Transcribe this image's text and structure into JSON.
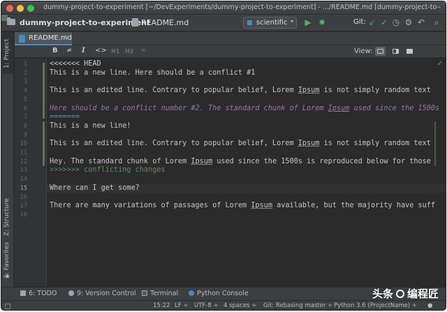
{
  "window": {
    "title": "dummy-project-to-experiment [~/DevExperiments/dummy-project-to-experiment] - .../README.md [dummy-project-to-experiment]"
  },
  "navbar": {
    "project": "dummy-project-to-experiment",
    "file": "README.md",
    "run_config": "scientific",
    "git_label": "Git:"
  },
  "left_tools": {
    "project": "1: Project",
    "structure": "Z: Structure",
    "favorites": "2: Favorites"
  },
  "tabs": [
    {
      "label": "README.md"
    }
  ],
  "md_toolbar": {
    "bold": "B",
    "strike": "≠",
    "italic": "I",
    "code": "<>",
    "h1": "H1",
    "h2": "H2",
    "link": "∞",
    "view_label": "View:"
  },
  "editor": {
    "current_line": 15,
    "line_numbers": [
      "1",
      "2",
      "3",
      "4",
      "5",
      "6",
      "7",
      "8",
      "9",
      "10",
      "11",
      "12",
      "13",
      "14",
      "15",
      "16",
      "17",
      "18"
    ],
    "lines": [
      "<<<<<<< HEAD",
      "This is a new line. Here should be a conflict #1",
      "",
      "This is an edited line. Contrary to popular belief, Lorem Ipsum is not simply random text",
      "",
      "Here should be a conflict number #2. The standard chunk of Lorem Ipsum used since the 1500s",
      "=======",
      "This is a new line!",
      "",
      "This is an edited line. Contrary to popular belief, Lorem Ipsum is not simply random text",
      "",
      "Hey. The standard chunk of Lorem Ipsum used since the 1500s is reproduced below for those",
      ">>>>>>> conflicting changes",
      "",
      "Where can I get some?",
      "",
      "There are many variations of passages of Lorem Ipsum available, but the majority have suff",
      ""
    ]
  },
  "bottom_tools": {
    "todo": "6: TODO",
    "version_control": "9: Version Control",
    "terminal": "Terminal",
    "python_console": "Python Console"
  },
  "status": {
    "position": "15:22",
    "line_sep": "LF ÷",
    "encoding": "UTF-8 ÷",
    "indent": "4 spaces ÷",
    "git": "Git: Rebasing master ÷",
    "interpreter": "Python 3.6 (ProjectName) ÷",
    "lock": "●"
  },
  "watermark": {
    "left": "头条",
    "right": "编程匠"
  },
  "colors": {
    "accent": "#4a88c7",
    "editor_bg": "#2b2b2b",
    "panel_bg": "#3c3f41",
    "run_green": "#59a869",
    "italic_purple": "#9876aa"
  }
}
